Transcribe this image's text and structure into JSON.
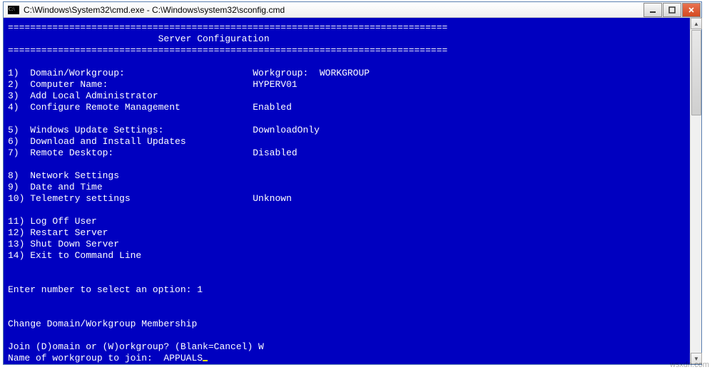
{
  "window": {
    "title": "C:\\Windows\\System32\\cmd.exe - C:\\Windows\\system32\\sconfig.cmd",
    "min_label": "Minimize",
    "max_label": "Maximize",
    "close_label": "Close"
  },
  "console": {
    "divider": "===============================================================================",
    "header": "                           Server Configuration",
    "rows": [
      {
        "n": "1)",
        "label": "Domain/Workgroup:",
        "value": "Workgroup:  WORKGROUP"
      },
      {
        "n": "2)",
        "label": "Computer Name:",
        "value": "HYPERV01"
      },
      {
        "n": "3)",
        "label": "Add Local Administrator",
        "value": ""
      },
      {
        "n": "4)",
        "label": "Configure Remote Management",
        "value": "Enabled"
      },
      {
        "n": "",
        "label": "",
        "value": ""
      },
      {
        "n": "5)",
        "label": "Windows Update Settings:",
        "value": "DownloadOnly"
      },
      {
        "n": "6)",
        "label": "Download and Install Updates",
        "value": ""
      },
      {
        "n": "7)",
        "label": "Remote Desktop:",
        "value": "Disabled"
      },
      {
        "n": "",
        "label": "",
        "value": ""
      },
      {
        "n": "8)",
        "label": "Network Settings",
        "value": ""
      },
      {
        "n": "9)",
        "label": "Date and Time",
        "value": ""
      },
      {
        "n": "10)",
        "label": "Telemetry settings",
        "value": "Unknown"
      },
      {
        "n": "",
        "label": "",
        "value": ""
      },
      {
        "n": "11)",
        "label": "Log Off User",
        "value": ""
      },
      {
        "n": "12)",
        "label": "Restart Server",
        "value": ""
      },
      {
        "n": "13)",
        "label": "Shut Down Server",
        "value": ""
      },
      {
        "n": "14)",
        "label": "Exit to Command Line",
        "value": ""
      }
    ],
    "prompt1": "Enter number to select an option: 1",
    "section": "Change Domain/Workgroup Membership",
    "prompt2": "Join (D)omain or (W)orkgroup? (Blank=Cancel) W",
    "prompt3_label": "Name of workgroup to join:  ",
    "prompt3_value": "APPUALS"
  },
  "watermark": "wsxdn.com"
}
